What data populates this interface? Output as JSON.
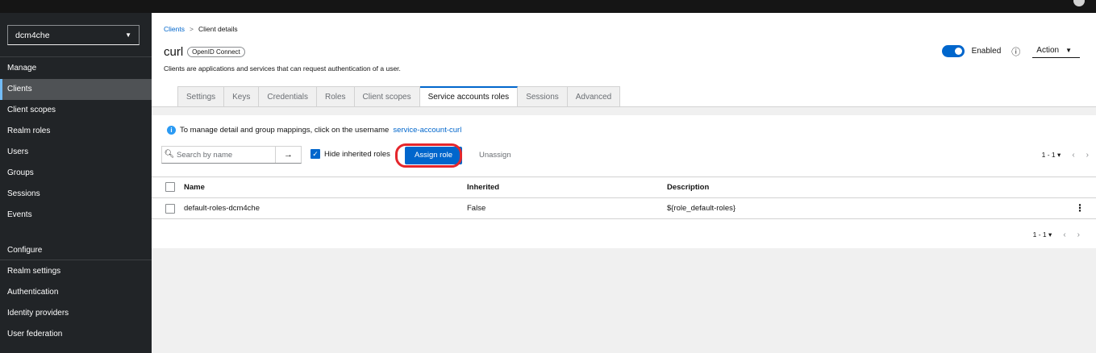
{
  "sidebar": {
    "realm": "dcm4che",
    "manage_label": "Manage",
    "configure_label": "Configure",
    "manage_items": [
      {
        "label": "Clients"
      },
      {
        "label": "Client scopes"
      },
      {
        "label": "Realm roles"
      },
      {
        "label": "Users"
      },
      {
        "label": "Groups"
      },
      {
        "label": "Sessions"
      },
      {
        "label": "Events"
      }
    ],
    "configure_items": [
      {
        "label": "Realm settings"
      },
      {
        "label": "Authentication"
      },
      {
        "label": "Identity providers"
      },
      {
        "label": "User federation"
      }
    ]
  },
  "breadcrumb": {
    "parent": "Clients",
    "separator": ">",
    "current": "Client details"
  },
  "header": {
    "title": "curl",
    "badge": "OpenID Connect",
    "subtitle": "Clients are applications and services that can request authentication of a user.",
    "enabled_label": "Enabled",
    "action_label": "Action"
  },
  "tabs": [
    {
      "label": "Settings"
    },
    {
      "label": "Keys"
    },
    {
      "label": "Credentials"
    },
    {
      "label": "Roles"
    },
    {
      "label": "Client scopes"
    },
    {
      "label": "Service accounts roles"
    },
    {
      "label": "Sessions"
    },
    {
      "label": "Advanced"
    }
  ],
  "service_accounts": {
    "info_text": "To manage detail and group mappings, click on the username",
    "info_link": "service-account-curl",
    "search_placeholder": "Search by name",
    "hide_inherited_label": "Hide inherited roles",
    "assign_label": "Assign role",
    "unassign_label": "Unassign",
    "pagination": "1 - 1",
    "columns": {
      "name": "Name",
      "inherited": "Inherited",
      "description": "Description"
    },
    "rows": [
      {
        "name": "default-roles-dcm4che",
        "inherited": "False",
        "description": "${role_default-roles}"
      }
    ]
  },
  "colors": {
    "sidebar_bg": "#212427",
    "primary": "#0066cc",
    "highlight_ring": "#e4262c"
  }
}
